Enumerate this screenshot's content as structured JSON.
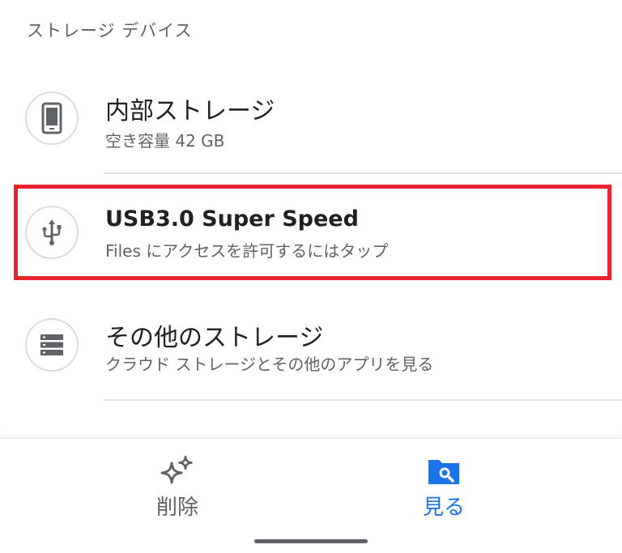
{
  "section": {
    "header": "ストレージ デバイス"
  },
  "storage": {
    "items": [
      {
        "title": "内部ストレージ",
        "subtitle": "空き容量 42 GB",
        "icon": "phone-icon"
      },
      {
        "title": "USB3.0  Super Speed",
        "subtitle": "Files にアクセスを許可するにはタップ",
        "icon": "usb-icon"
      },
      {
        "title": "その他のストレージ",
        "subtitle": "クラウド ストレージとその他のアプリを見る",
        "icon": "storage-list-icon"
      }
    ]
  },
  "bottom_nav": {
    "items": [
      {
        "label": "削除",
        "icon": "sparkle-icon",
        "active": false
      },
      {
        "label": "見る",
        "icon": "folder-search-icon",
        "active": true
      }
    ]
  },
  "colors": {
    "accent": "#1a73e8",
    "highlight": "#e8232d",
    "text_primary": "#202124",
    "text_secondary": "#5f6368",
    "divider": "#e0e0e0"
  }
}
